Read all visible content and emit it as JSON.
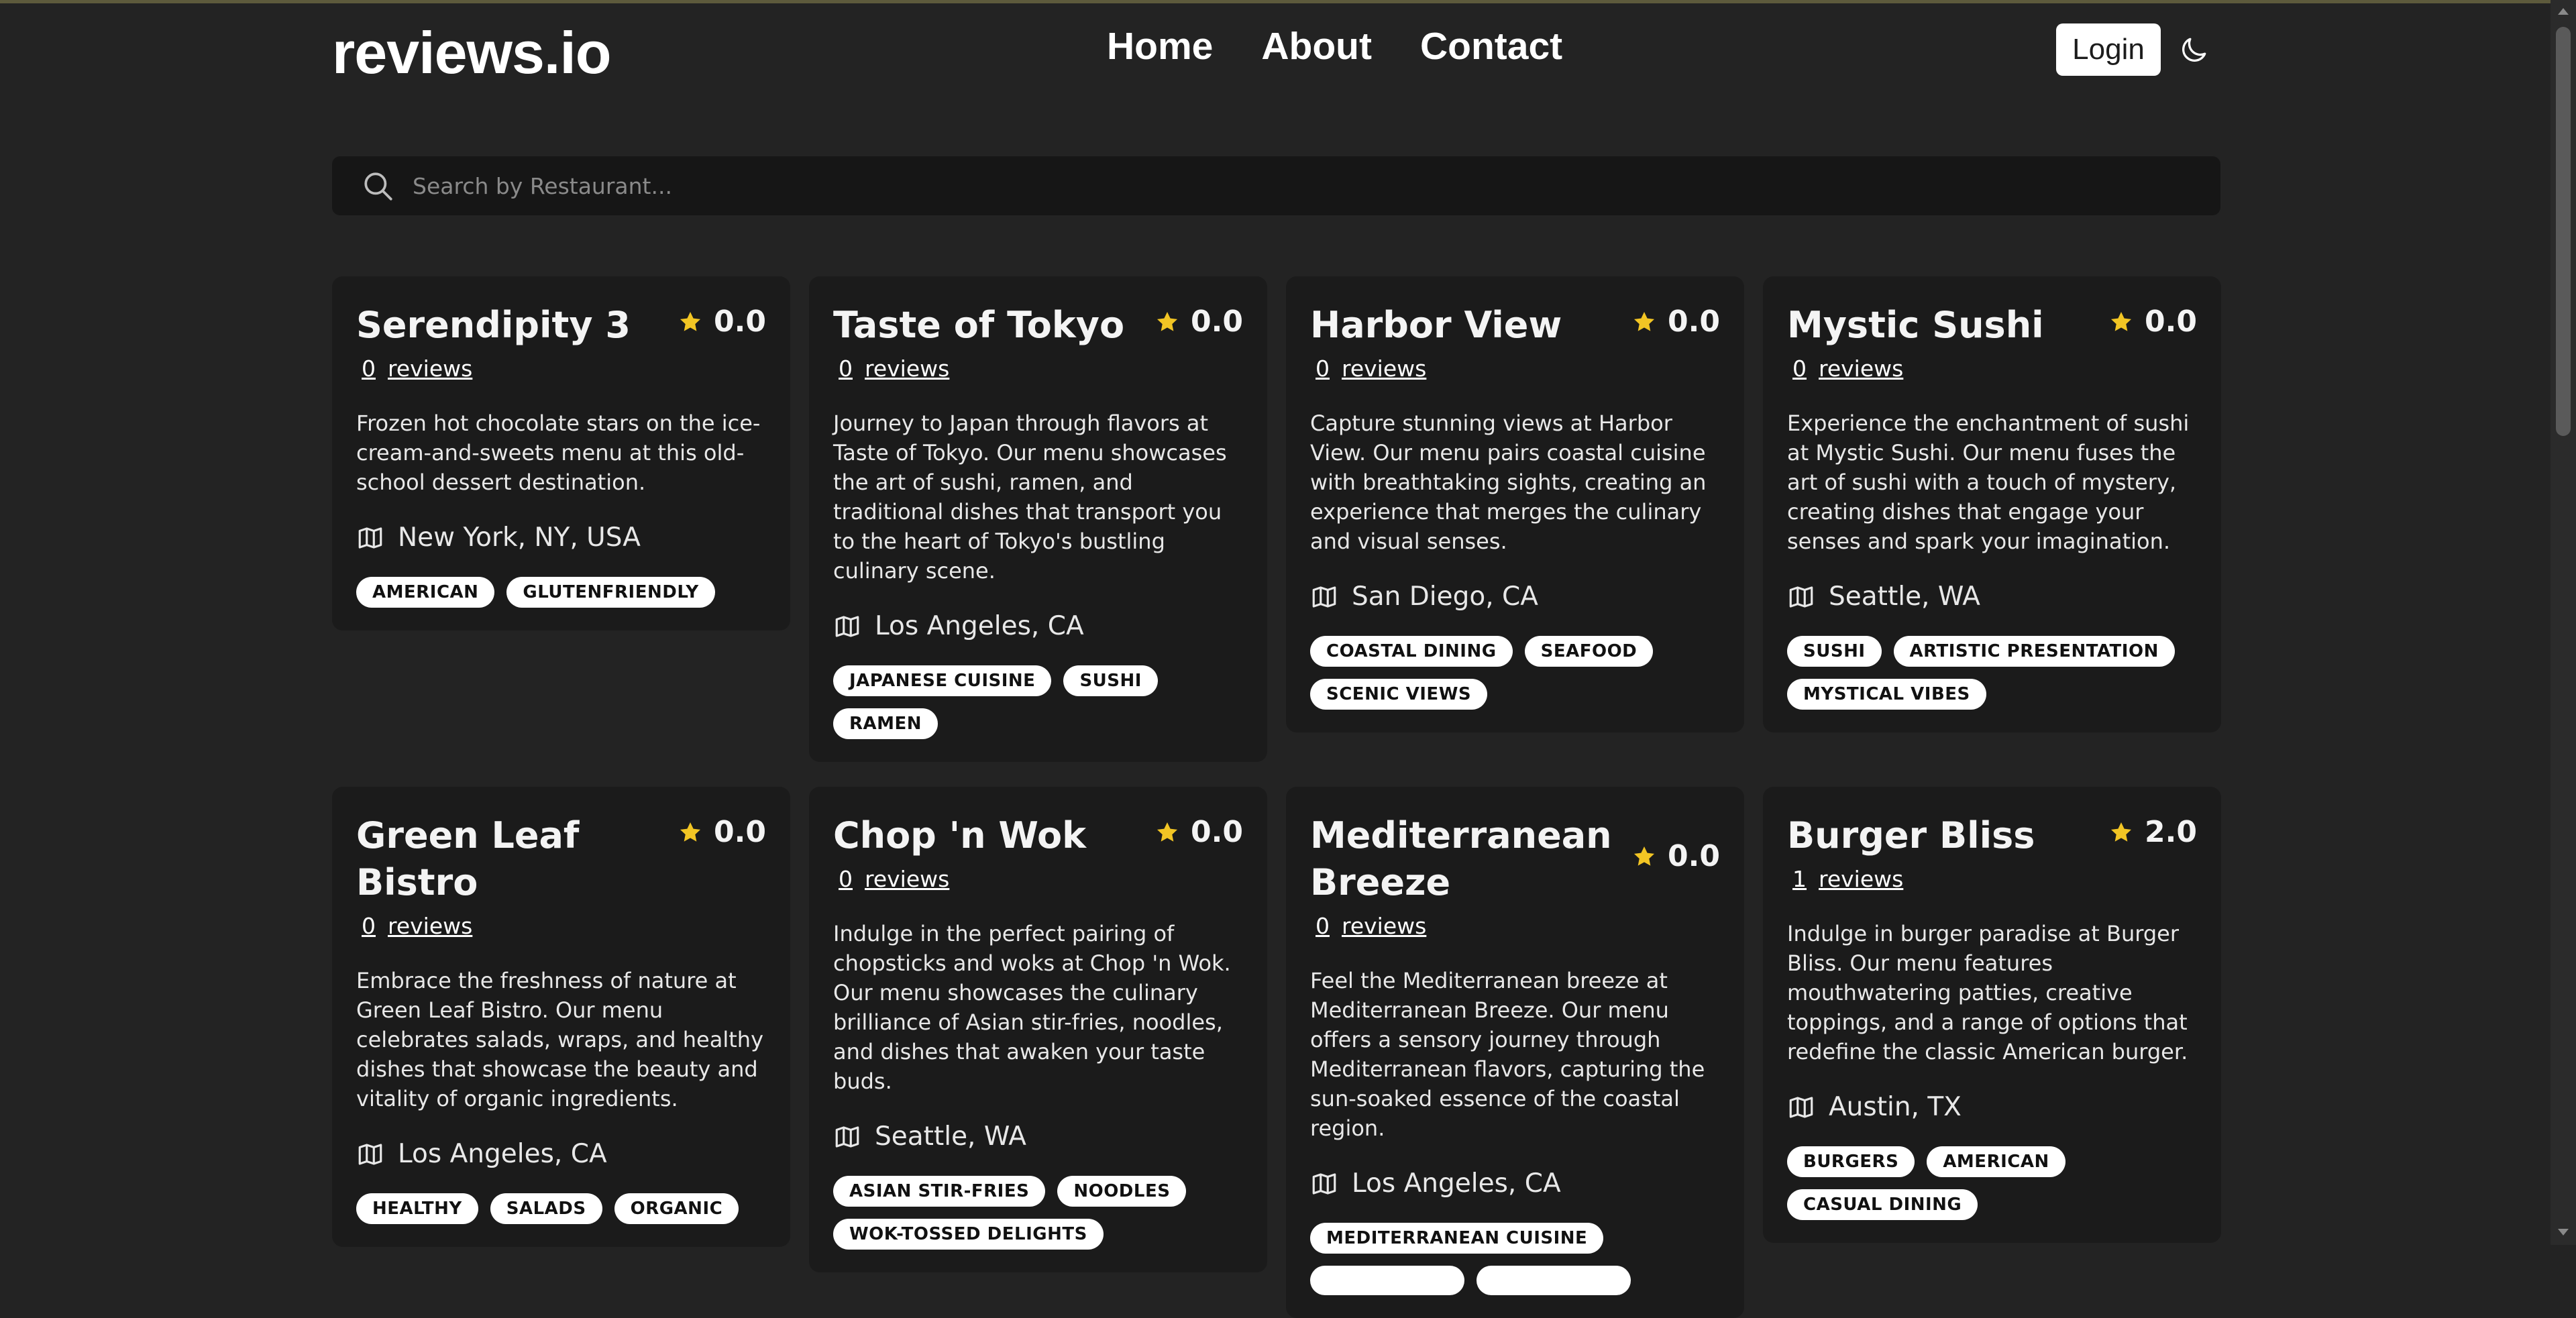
{
  "header": {
    "logo": "reviews.io",
    "nav": [
      "Home",
      "About",
      "Contact"
    ],
    "login_label": "Login",
    "theme_icon": "moon-icon"
  },
  "search": {
    "placeholder": "Search by Restaurant...",
    "icon": "search-icon"
  },
  "colors": {
    "background": "#232323",
    "card": "#1b1b1b",
    "star": "#f2c524",
    "tag_bg": "#ffffff"
  },
  "restaurants": [
    {
      "name": "Serendipity 3",
      "rating": "0.0",
      "review_count": "0",
      "reviews_label": "reviews",
      "description": "Frozen hot chocolate stars on the ice-cream-and-sweets menu at this old-school dessert destination.",
      "location": "New York, NY, USA",
      "tags": [
        "AMERICAN",
        "GLUTENFRIENDLY"
      ]
    },
    {
      "name": "Taste of Tokyo",
      "rating": "0.0",
      "review_count": "0",
      "reviews_label": "reviews",
      "description": "Journey to Japan through flavors at Taste of Tokyo. Our menu showcases the art of sushi, ramen, and traditional dishes that transport you to the heart of Tokyo's bustling culinary scene.",
      "location": "Los Angeles, CA",
      "tags": [
        "JAPANESE CUISINE",
        "SUSHI",
        "RAMEN"
      ]
    },
    {
      "name": "Harbor View",
      "rating": "0.0",
      "review_count": "0",
      "reviews_label": "reviews",
      "description": "Capture stunning views at Harbor View. Our menu pairs coastal cuisine with breathtaking sights, creating an experience that merges the culinary and visual senses.",
      "location": "San Diego, CA",
      "tags": [
        "COASTAL DINING",
        "SEAFOOD",
        "SCENIC VIEWS"
      ]
    },
    {
      "name": "Mystic Sushi",
      "rating": "0.0",
      "review_count": "0",
      "reviews_label": "reviews",
      "description": "Experience the enchantment of sushi at Mystic Sushi. Our menu fuses the art of sushi with a touch of mystery, creating dishes that engage your senses and spark your imagination.",
      "location": "Seattle, WA",
      "tags": [
        "SUSHI",
        "ARTISTIC PRESENTATION",
        "MYSTICAL VIBES"
      ]
    },
    {
      "name": "Green Leaf Bistro",
      "rating": "0.0",
      "review_count": "0",
      "reviews_label": "reviews",
      "description": "Embrace the freshness of nature at Green Leaf Bistro. Our menu celebrates salads, wraps, and healthy dishes that showcase the beauty and vitality of organic ingredients.",
      "location": "Los Angeles, CA",
      "tags": [
        "HEALTHY",
        "SALADS",
        "ORGANIC"
      ]
    },
    {
      "name": "Chop 'n Wok",
      "rating": "0.0",
      "review_count": "0",
      "reviews_label": "reviews",
      "description": "Indulge in the perfect pairing of chopsticks and woks at Chop 'n Wok. Our menu showcases the culinary brilliance of Asian stir-fries, noodles, and dishes that awaken your taste buds.",
      "location": "Seattle, WA",
      "tags": [
        "ASIAN STIR-FRIES",
        "NOODLES",
        "WOK-TOSSED DELIGHTS"
      ]
    },
    {
      "name": "Mediterranean Breeze",
      "rating": "0.0",
      "review_count": "0",
      "reviews_label": "reviews",
      "description": "Feel the Mediterranean breeze at Mediterranean Breeze. Our menu offers a sensory journey through Mediterranean flavors, capturing the sun-soaked essence of the coastal region.",
      "location": "Los Angeles, CA",
      "tags": [
        "MEDITERRANEAN CUISINE",
        "",
        ""
      ]
    },
    {
      "name": "Burger Bliss",
      "rating": "2.0",
      "review_count": "1",
      "reviews_label": "reviews",
      "description": "Indulge in burger paradise at Burger Bliss. Our menu features mouthwatering patties, creative toppings, and a range of options that redefine the classic American burger.",
      "location": "Austin, TX",
      "tags": [
        "BURGERS",
        "AMERICAN",
        "CASUAL DINING"
      ]
    }
  ]
}
